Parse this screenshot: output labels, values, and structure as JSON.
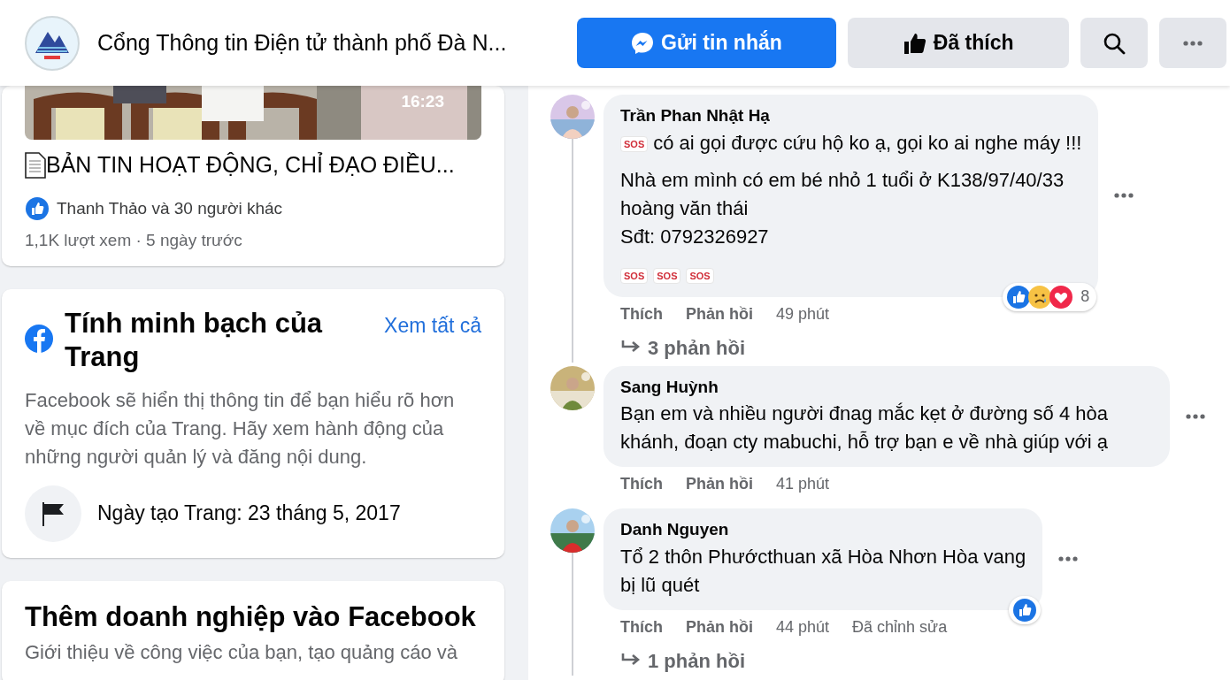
{
  "header": {
    "title": "Cổng Thông tin Điện tử thành phố Đà N...",
    "buttons": [
      {
        "label": "Gửi tin nhắn",
        "kind": "message"
      },
      {
        "label": "Đã thích",
        "kind": "liked"
      }
    ],
    "icon_buttons": [
      {
        "kind": "search"
      },
      {
        "kind": "more"
      }
    ]
  },
  "video_post": {
    "duration": "16:23",
    "title": "BẢN TIN HOẠT ĐỘNG, CHỈ ĐẠO ĐIỀU...",
    "reactions": "Thanh Thảo và 30 người khác",
    "meta": "1,1K lượt xem · 5 ngày trước"
  },
  "transparency": {
    "title": "Tính minh bạch của Trang",
    "link": "Xem tất cả",
    "description": "Facebook sẽ hiển thị thông tin để bạn hiểu rõ hơn về mục đích của Trang. Hãy xem hành động của những người quản lý và đăng nội dung.",
    "created": "Ngày tạo Trang: 23 tháng 5, 2017"
  },
  "business": {
    "title": "Thêm doanh nghiệp vào Facebook",
    "description": "Giới thiệu về công việc của bạn, tạo quảng cáo và"
  },
  "comments": [
    {
      "author": "Trần Phan Nhật Hạ",
      "prefix_emoji": "SOS",
      "paragraphs": [
        "có ai gọi được cứu hộ ko ạ, gọi ko ai nghe máy !!!",
        "Nhà em mình có em bé nhỏ 1 tuổi ở K138/97/40/33\nhoàng văn thái\nSđt: 0792326927"
      ],
      "trailing_emojis": [
        "SOS",
        "SOS",
        "SOS"
      ],
      "like": "Thích",
      "reply": "Phản hồi",
      "time": "49 phút",
      "reactions": [
        {
          "kind": "like"
        },
        {
          "kind": "sad"
        },
        {
          "kind": "love"
        }
      ],
      "reaction_count": "8",
      "replies": "3 phản hồi"
    },
    {
      "author": "Sang Huỳnh",
      "paragraphs": [
        "Bạn em và nhiều người đnag mắc kẹt ở đường số 4 hòa khánh, đoạn cty mabuchi, hỗ trợ bạn e về nhà giúp với ạ"
      ],
      "like": "Thích",
      "reply": "Phản hồi",
      "time": "41 phút"
    },
    {
      "author": "Danh Nguyen",
      "paragraphs": [
        "Tổ 2 thôn Phướcthuan xã Hòa Nhơn Hòa vang\nbị lũ quét"
      ],
      "like": "Thích",
      "reply": "Phản hồi",
      "time": "44 phút",
      "edited": "Đã chỉnh sửa",
      "reactions": [
        {
          "kind": "like"
        }
      ],
      "replies": "1 phản hồi"
    }
  ]
}
